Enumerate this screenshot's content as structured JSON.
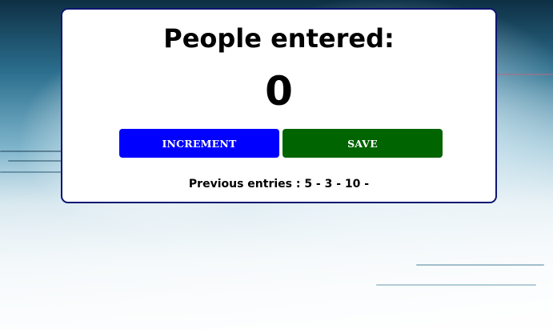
{
  "counter": {
    "title": "People entered:",
    "count": "0"
  },
  "buttons": {
    "increment_label": "INCREMENT",
    "save_label": "SAVE"
  },
  "history": {
    "text": "Previous entries : 5 - 3 - 10 -"
  },
  "colors": {
    "increment_button": "#0000ff",
    "save_button": "#006400",
    "card_border": "#0d1573"
  }
}
